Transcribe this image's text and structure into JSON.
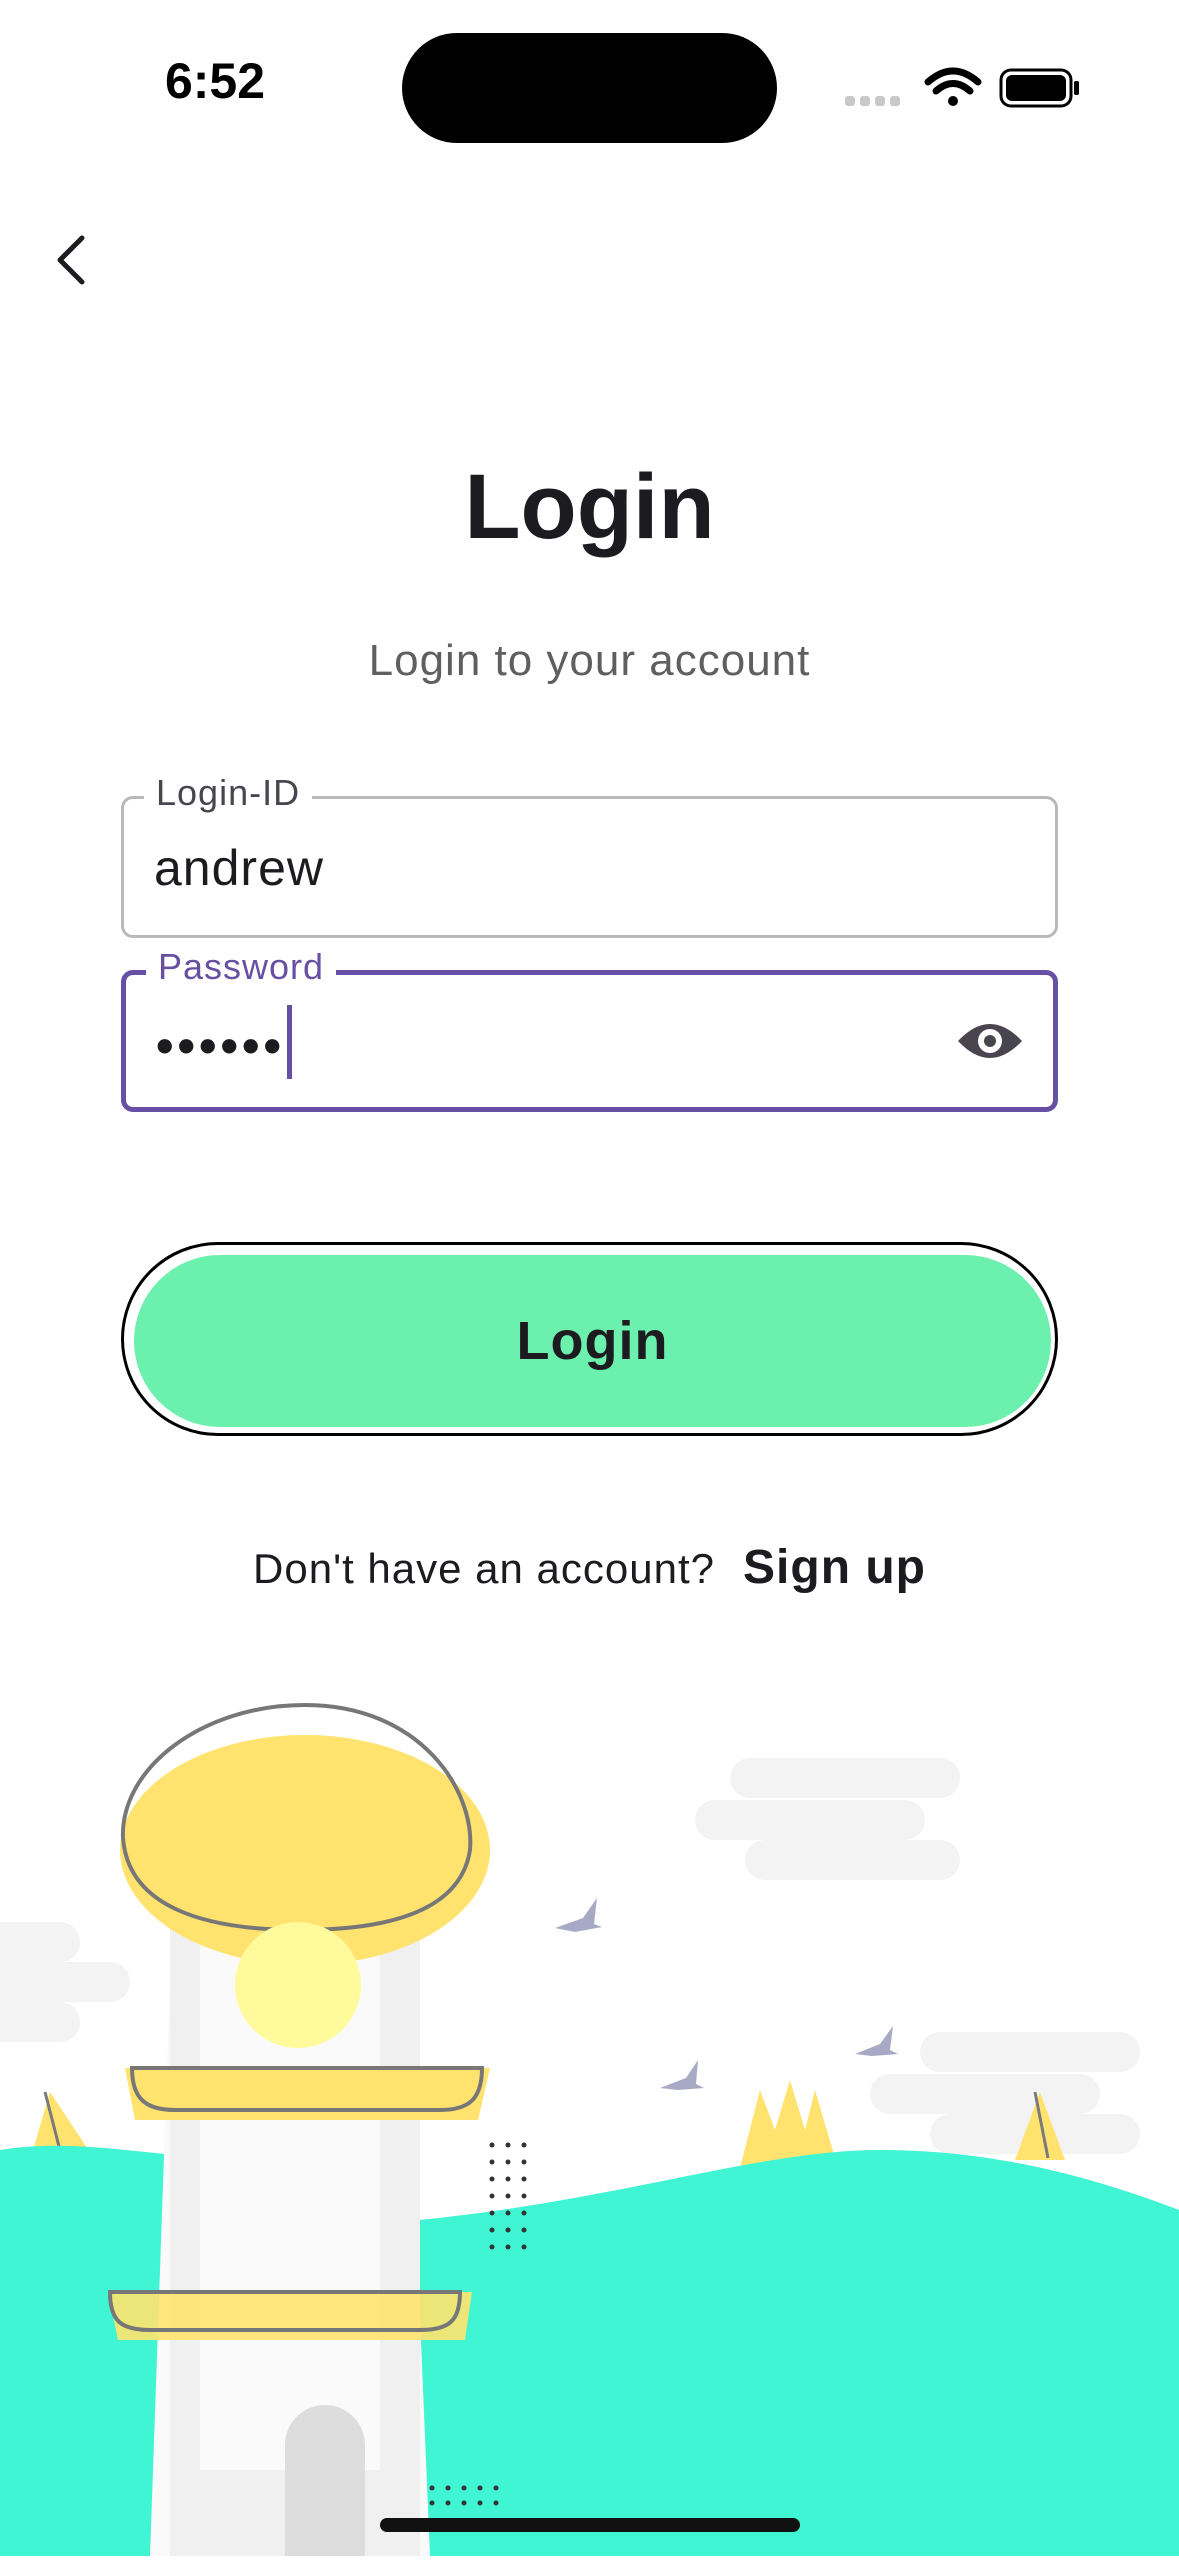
{
  "status_bar": {
    "time": "6:52",
    "icons": [
      "cellular-signal-icon",
      "wifi-icon",
      "battery-icon"
    ]
  },
  "nav": {
    "back_icon": "chevron-left-icon"
  },
  "header": {
    "title": "Login",
    "subtitle": "Login to your account"
  },
  "form": {
    "login_id": {
      "label": "Login-ID",
      "value": "andrew"
    },
    "password": {
      "label": "Password",
      "value": "••••••",
      "toggle_icon": "eye-icon"
    },
    "submit_label": "Login"
  },
  "signup": {
    "prompt": "Don't have an account?",
    "link_label": "Sign up"
  },
  "colors": {
    "accent_purple": "#6750a4",
    "button_green": "#6bf0ae",
    "hill_teal": "#3ff5d3",
    "lighthouse_yellow": "#ffe36e"
  }
}
